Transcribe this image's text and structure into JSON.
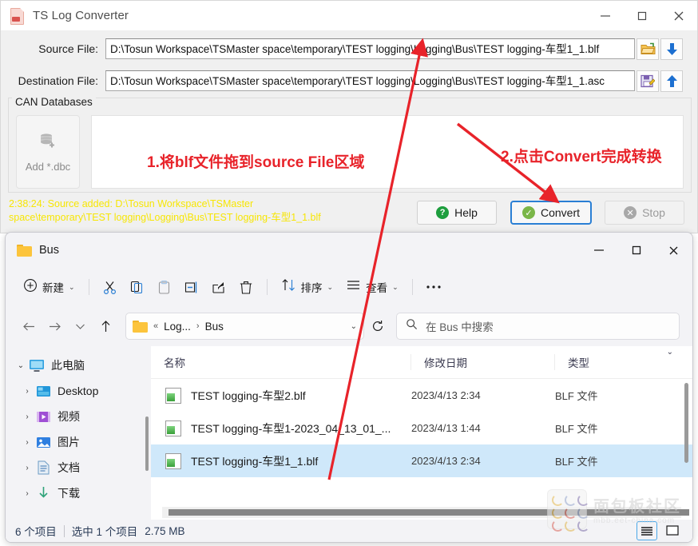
{
  "converter": {
    "title": "TS Log Converter",
    "window_controls": {
      "minimize": "minimize-icon",
      "maximize": "maximize-icon",
      "close": "close-icon"
    },
    "source": {
      "label": "Source File:",
      "value": "D:\\Tosun Workspace\\TSMaster space\\temporary\\TEST logging\\Logging\\Bus\\TEST logging-车型1_1.blf",
      "browse_icon": "open-folder-icon",
      "load_icon": "down-arrow-icon"
    },
    "destination": {
      "label": "Destination File:",
      "value": "D:\\Tosun Workspace\\TSMaster space\\temporary\\TEST logging\\Logging\\Bus\\TEST logging-车型1_1.asc",
      "save_icon": "save-disk-icon",
      "export_icon": "up-arrow-icon"
    },
    "can_databases": {
      "legend": "CAN Databases",
      "add_button_label": "Add *.dbc",
      "add_button_icon": "database-add-icon"
    },
    "annotations": [
      {
        "text": "1.将blf文件拖到source File区域",
        "color": "#e8232a"
      },
      {
        "text": "2.点击Convert完成转换",
        "color": "#e8232a"
      }
    ],
    "log": {
      "color": "#f7e605",
      "lines": [
        "2:38:24: Source added: D:\\Tosun Workspace\\TSMaster",
        "space\\temporary\\TEST logging\\Logging\\Bus\\TEST logging-车型1_1.blf"
      ]
    },
    "actions": [
      {
        "label": "Help",
        "icon": "help-circle-icon",
        "state": "enabled",
        "accent": "#1e9e3e"
      },
      {
        "label": "Convert",
        "icon": "check-circle-icon",
        "state": "focused",
        "accent": "#7ab648"
      },
      {
        "label": "Stop",
        "icon": "stop-circle-icon",
        "state": "disabled",
        "accent": "#9a9a9a"
      }
    ]
  },
  "explorer": {
    "title": "Bus",
    "title_icon": "folder-icon",
    "window_controls": {
      "minimize": "minimize-icon",
      "maximize": "maximize-icon",
      "close": "close-icon"
    },
    "toolbar": {
      "new_label": "新建",
      "new_icon": "plus-circle-icon",
      "cut_icon": "scissors-icon",
      "copy_icon": "copy-icon",
      "paste_icon": "paste-icon",
      "rename_icon": "rename-icon",
      "share_icon": "share-icon",
      "delete_icon": "trash-icon",
      "sort_label": "排序",
      "sort_icon": "sort-arrows-icon",
      "view_label": "查看",
      "view_icon": "view-lines-icon",
      "more_icon": "ellipsis-icon"
    },
    "addressbar": {
      "back_icon": "arrow-left-icon",
      "forward_icon": "arrow-right-icon",
      "recent_icon": "chevron-down-icon",
      "up_icon": "arrow-up-icon",
      "refresh_icon": "refresh-icon",
      "folder_icon": "folder-icon",
      "breadcrumb": [
        "«",
        "Log...",
        "Bus"
      ],
      "dropdown_icon": "chevron-down-icon",
      "search_icon": "search-icon",
      "search_placeholder": "在 Bus 中搜索"
    },
    "nav": {
      "items": [
        {
          "label": "此电脑",
          "icon": "monitor-icon",
          "expander": "chevron-down-icon",
          "level": 0
        },
        {
          "label": "Desktop",
          "icon": "desktop-icon",
          "expander": "chevron-right-icon",
          "level": 1
        },
        {
          "label": "视频",
          "icon": "videos-icon",
          "expander": "chevron-right-icon",
          "level": 1
        },
        {
          "label": "图片",
          "icon": "pictures-icon",
          "expander": "chevron-right-icon",
          "level": 1
        },
        {
          "label": "文档",
          "icon": "documents-icon",
          "expander": "chevron-right-icon",
          "level": 1
        },
        {
          "label": "下载",
          "icon": "downloads-icon",
          "expander": "chevron-right-icon",
          "level": 1
        }
      ]
    },
    "columns": [
      "名称",
      "修改日期",
      "类型"
    ],
    "files": [
      {
        "name": "TEST logging-车型2.blf",
        "date": "2023/4/13 2:34",
        "type": "BLF 文件",
        "selected": false,
        "icon": "blf-file-icon"
      },
      {
        "name": "TEST logging-车型1-2023_04_13_01_...",
        "date": "2023/4/13 1:44",
        "type": "BLF 文件",
        "selected": false,
        "icon": "blf-file-icon"
      },
      {
        "name": "TEST logging-车型1_1.blf",
        "date": "2023/4/13 2:34",
        "type": "BLF 文件",
        "selected": true,
        "icon": "blf-file-icon"
      }
    ],
    "status": {
      "item_count": "6 个项目",
      "selection": "选中 1 个项目",
      "size": "2.75 MB",
      "details_view_icon": "details-view-icon",
      "pane_view_icon": "preview-pane-icon"
    }
  },
  "watermark": {
    "cn": "面包板社区",
    "en": "mbb.eet-china.com"
  }
}
